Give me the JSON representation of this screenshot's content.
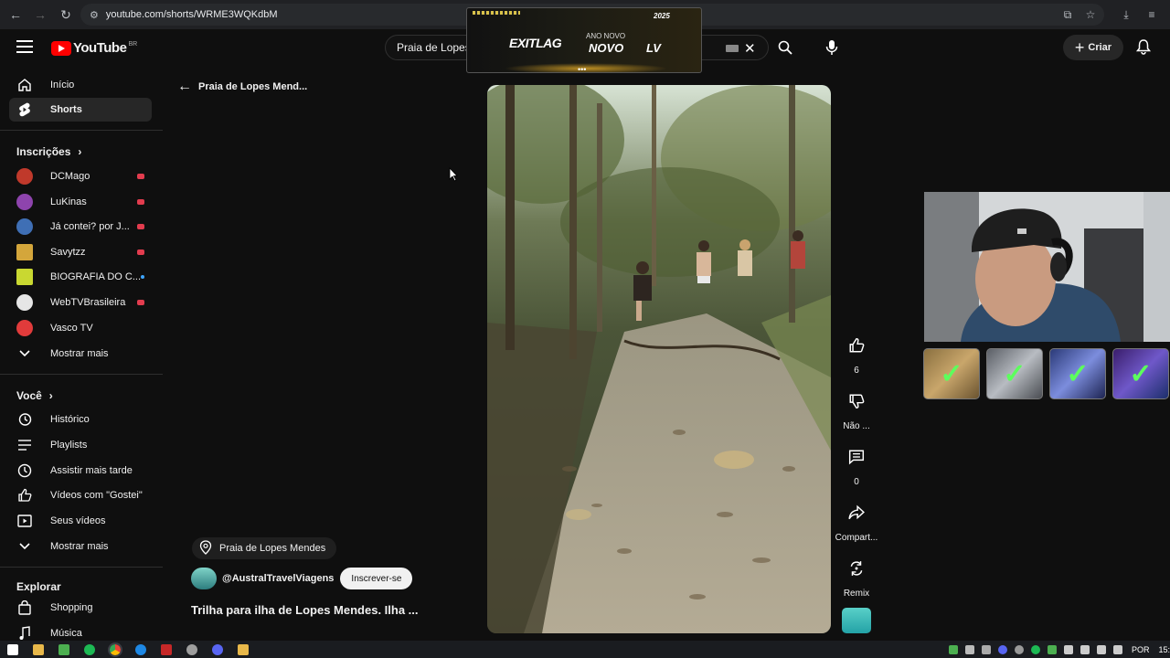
{
  "browser": {
    "url": "youtube.com/shorts/WRME3WQKdbM"
  },
  "header": {
    "logo_text": "YouTube",
    "country_code": "BR",
    "search_value": "Praia de Lopes",
    "create_label": "Criar"
  },
  "ad": {
    "brand": "EXITLAG",
    "line1": "ANO NOVO",
    "line2": "NOVO",
    "line3": "LV",
    "year": "2025",
    "dots": "•••"
  },
  "sidebar": {
    "main": [
      {
        "label": "Início",
        "icon": "home-icon"
      },
      {
        "label": "Shorts",
        "icon": "shorts-icon",
        "active": true
      }
    ],
    "subs_header": "Inscrições",
    "subscriptions": [
      {
        "label": "DCMago",
        "color": "#c0392b",
        "live": "#e23c4e"
      },
      {
        "label": "LuKinas",
        "color": "#8e44ad",
        "live": "#e23c4e"
      },
      {
        "label": "Já contei? por J...",
        "color": "#3f6fb5",
        "live": "#e23c4e"
      },
      {
        "label": "Savytzz",
        "color": "#d4a63b",
        "live": "#e23c4e"
      },
      {
        "label": "BIOGRAFIA DO C...",
        "color": "#c9d831",
        "live": "#3ea6ff"
      },
      {
        "label": "WebTVBrasileira",
        "color": "#e6e6e6",
        "live": "#e23c4e"
      },
      {
        "label": "Vasco TV",
        "color": "#e13b3b",
        "live": ""
      }
    ],
    "show_more_1": "Mostrar mais",
    "you_header": "Você",
    "you_items": [
      {
        "label": "Histórico",
        "icon": "history-icon"
      },
      {
        "label": "Playlists",
        "icon": "playlists-icon"
      },
      {
        "label": "Assistir mais tarde",
        "icon": "watch-later-icon"
      },
      {
        "label": "Vídeos com \"Gostei\"",
        "icon": "liked-icon"
      },
      {
        "label": "Seus vídeos",
        "icon": "your-videos-icon"
      }
    ],
    "show_more_2": "Mostrar mais",
    "explore_header": "Explorar",
    "explore_items": [
      {
        "label": "Shopping",
        "icon": "shopping-icon"
      },
      {
        "label": "Música",
        "icon": "music-icon"
      }
    ]
  },
  "shorts": {
    "back_label": "Praia de Lopes Mend...",
    "location_chip": "Praia de Lopes Mendes",
    "channel_name": "@AustralTravelViagens",
    "subscribe_label": "Inscrever-se",
    "title": "Trilha para ilha de Lopes Mendes. Ilha ...",
    "actions": [
      {
        "name": "like",
        "icon": "thumbs-up-icon",
        "label": "6"
      },
      {
        "name": "dislike",
        "icon": "thumbs-down-icon",
        "label": "Não ..."
      },
      {
        "name": "comments",
        "icon": "comment-icon",
        "label": "0"
      },
      {
        "name": "share",
        "icon": "share-icon",
        "label": "Compart..."
      },
      {
        "name": "remix",
        "icon": "remix-icon",
        "label": "Remix"
      }
    ]
  },
  "taskbar": {
    "language": "POR",
    "time": "15:"
  }
}
